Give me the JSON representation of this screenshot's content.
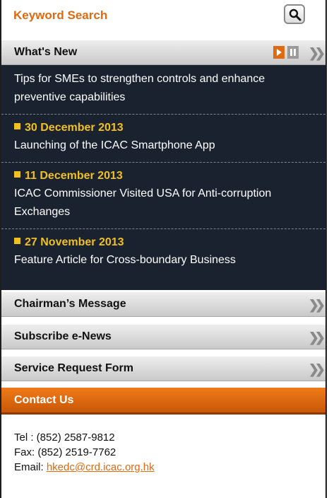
{
  "keyword": {
    "title": "Keyword Search"
  },
  "whats_new": {
    "label": "What's New",
    "items": [
      {
        "date": "",
        "text": "Tips for SMEs to strengthen controls and enhance preventive capabilities"
      },
      {
        "date": "30 December 2013",
        "text": "Launching of the ICAC Smartphone App"
      },
      {
        "date": "11 December 2013",
        "text": "ICAC Commissioner Visited USA for Anti-corruption Exchanges"
      },
      {
        "date": "27 November 2013",
        "text": "Feature Article for Cross-boundary Business"
      }
    ]
  },
  "menu": [
    {
      "label": "Chairman’s Message"
    },
    {
      "label": "Subscribe e-News"
    },
    {
      "label": "Service Request Form"
    }
  ],
  "contact": {
    "label": "Contact Us",
    "tel": "Tel : (852) 2587-9812",
    "fax": "Fax: (852) 2519-7762",
    "email_prefix": "Email: ",
    "email": "hkedc@crd.icac.org.hk"
  },
  "icons": {
    "search": "search-icon",
    "play": "play-icon",
    "pause": "pause-icon",
    "chevron": "double-chevron-icon"
  },
  "colors": {
    "accent": "#e06a10",
    "news_bg": "#1a2230",
    "date_yellow": "#f0c020"
  }
}
